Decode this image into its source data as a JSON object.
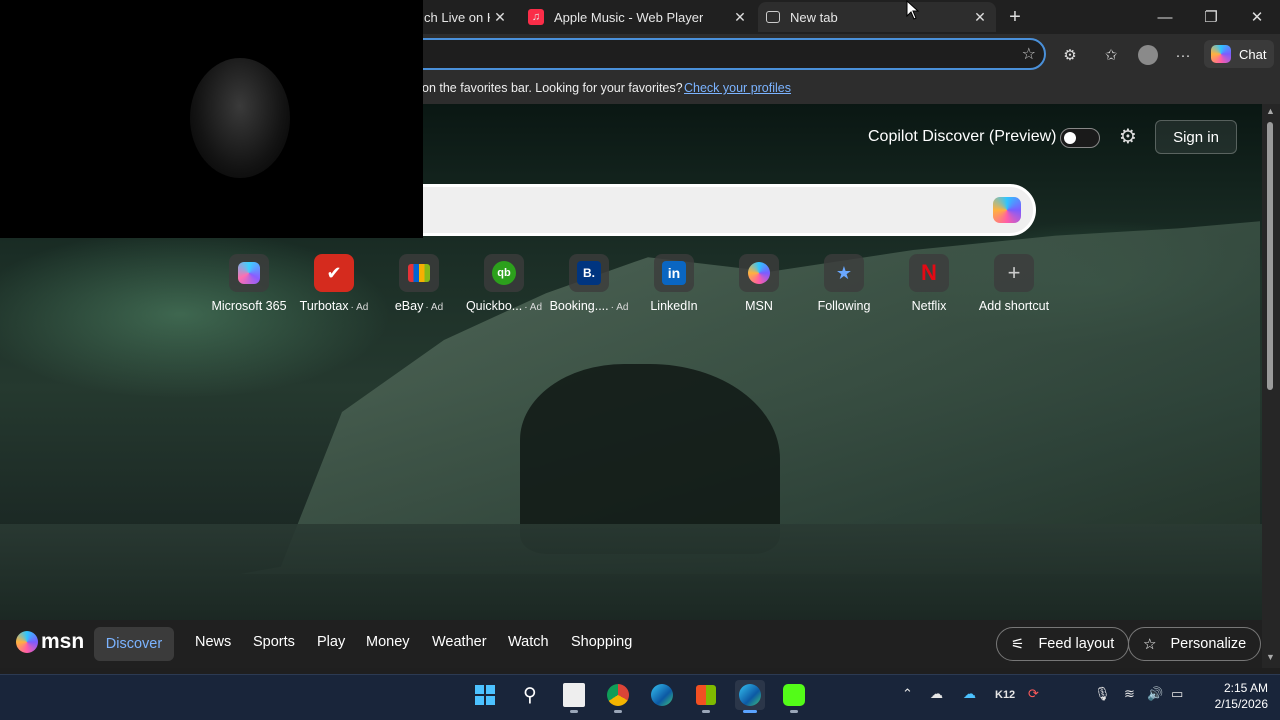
{
  "browser": {
    "tabs": [
      {
        "title": "ch Live on Ki",
        "icon": "kick-icon"
      },
      {
        "title": "Apple Music - Web Player",
        "icon": "apple-music-icon"
      },
      {
        "title": "New tab",
        "icon": "new-tab-icon"
      }
    ],
    "chat_label": "Chat",
    "favorites_bar": {
      "message": "on the favorites bar. Looking for your favorites?",
      "link": "Check your profiles"
    }
  },
  "newtab": {
    "copilot_discover_label": "Copilot Discover (Preview)",
    "copilot_toggle_on": false,
    "sign_in": "Sign in",
    "search_placeholder": "",
    "shortcuts": [
      {
        "label": "Microsoft 365",
        "ad": "",
        "icon": "microsoft-365-icon"
      },
      {
        "label": "Turbotax",
        "ad": "· Ad",
        "icon": "turbotax-icon"
      },
      {
        "label": "eBay",
        "ad": "· Ad",
        "icon": "ebay-icon"
      },
      {
        "label": "Quickbo...",
        "ad": "· Ad",
        "icon": "quickbooks-icon"
      },
      {
        "label": "Booking....",
        "ad": "· Ad",
        "icon": "booking-icon"
      },
      {
        "label": "LinkedIn",
        "ad": "",
        "icon": "linkedin-icon"
      },
      {
        "label": "MSN",
        "ad": "",
        "icon": "msn-icon"
      },
      {
        "label": "Following",
        "ad": "",
        "icon": "following-icon"
      },
      {
        "label": "Netflix",
        "ad": "",
        "icon": "netflix-icon"
      },
      {
        "label": "Add shortcut",
        "ad": "",
        "icon": "plus-icon"
      }
    ],
    "tile_glyphs": {
      "ebay": "",
      "quickbooks": "qb",
      "booking": "B.",
      "linkedin": "in",
      "netflix": "N",
      "plus": "+"
    }
  },
  "msn": {
    "logo": "msn",
    "nav": [
      "Discover",
      "News",
      "Sports",
      "Play",
      "Money",
      "Weather",
      "Watch",
      "Shopping"
    ],
    "feed_layout": "Feed layout",
    "personalize": "Personalize"
  },
  "taskbar": {
    "k12_label": "K12",
    "time": "2:15 AM",
    "date": "2/15/2026"
  },
  "colors": {
    "accent": "#4a90d9",
    "discover_text": "#7bb3ff",
    "taskbar": "#19253a",
    "netflix": "#e50914",
    "linkedin": "#0a66c2"
  }
}
